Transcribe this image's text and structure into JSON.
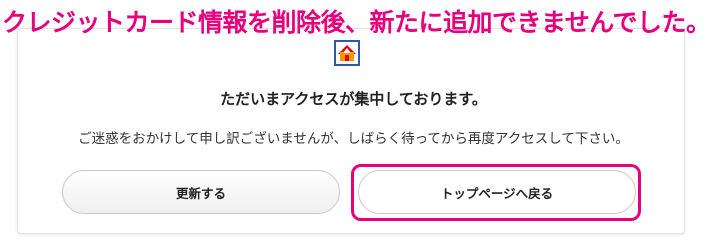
{
  "annotation": {
    "text": "クレジットカード情報を削除後、新たに追加できませんでした。",
    "color": "#e6007e"
  },
  "logo": {
    "icon": "house-logo-icon",
    "colors": {
      "border": "#2f5aa8",
      "roof": "#e60012",
      "body": "#f39800"
    }
  },
  "error": {
    "heading": "ただいまアクセスが集中しております。",
    "message": "ご迷惑をおかけして申し訳ございませんが、しばらく待ってから再度アクセスして下さい。"
  },
  "buttons": {
    "refresh_label": "更新する",
    "top_page_label": "トップページへ戻る"
  }
}
